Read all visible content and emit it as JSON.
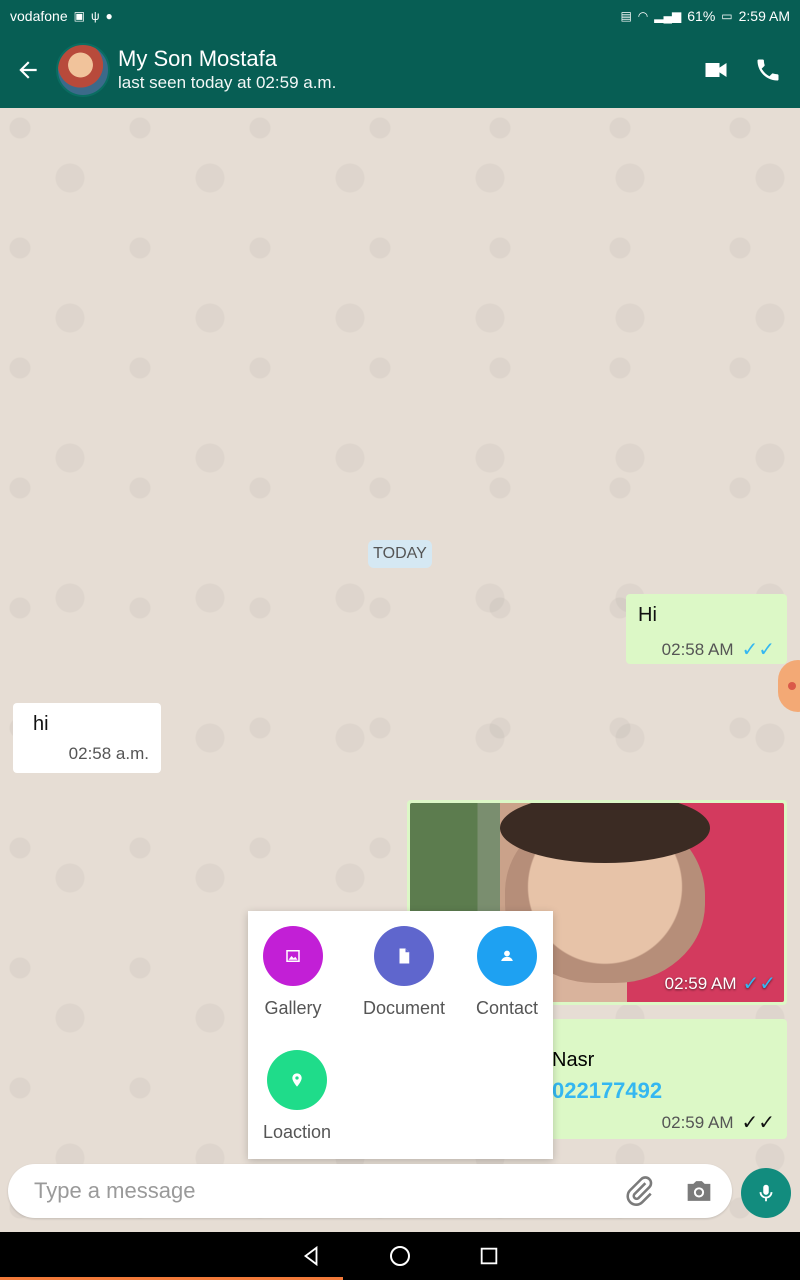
{
  "status_bar": {
    "carrier": "vodafone",
    "battery": "61%",
    "time": "2:59 AM"
  },
  "header": {
    "contact_name": "My Son Mostafa",
    "last_seen": "last seen today at 02:59 a.m."
  },
  "chat": {
    "date_separator": "TODAY",
    "messages": [
      {
        "direction": "out",
        "text": "Hi",
        "time": "02:58 AM",
        "ticks": "✓✓",
        "status": "read"
      },
      {
        "direction": "in",
        "text": "hi",
        "time": "02:58 a.m."
      },
      {
        "direction": "out",
        "type": "image",
        "time": "02:59 AM",
        "ticks": "✓✓",
        "status": "read"
      },
      {
        "direction": "out",
        "type": "contact",
        "name": "Nasr",
        "phone": "022177492",
        "time": "02:59 AM",
        "ticks": "✓✓",
        "status": "delivered"
      }
    ]
  },
  "attachment_menu": {
    "items": [
      {
        "label": "Gallery",
        "color": "#c21fd6",
        "icon": "gallery-icon"
      },
      {
        "label": "Document",
        "color": "#5f66cd",
        "icon": "document-icon"
      },
      {
        "label": "Contact",
        "color": "#1ea1f2",
        "icon": "contact-icon"
      },
      {
        "label": "Loaction",
        "color": "#1fdc8a",
        "icon": "location-icon"
      }
    ]
  },
  "composer": {
    "placeholder": "Type a message"
  },
  "colors": {
    "primary": "#075e54",
    "accent": "#128c7e",
    "outgoing_bubble": "#dcf8c6",
    "read_ticks": "#34b7f1"
  }
}
